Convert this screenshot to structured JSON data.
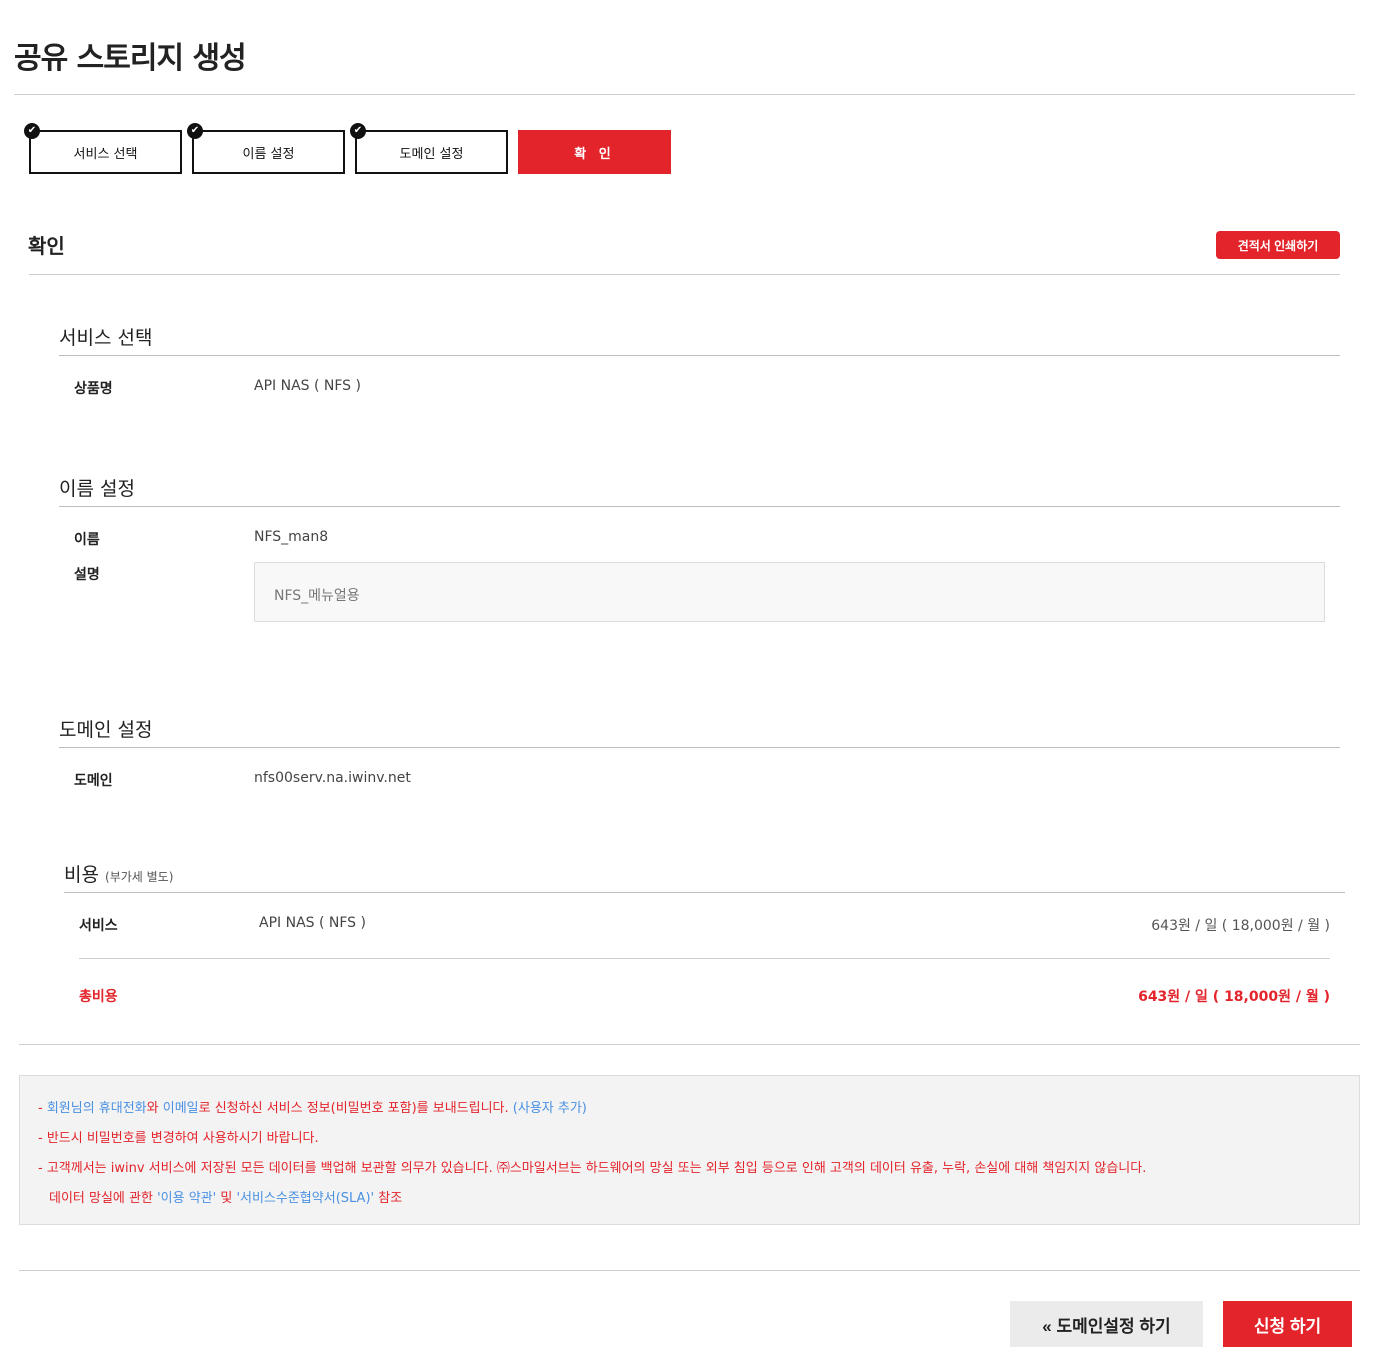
{
  "page_title": "공유 스토리지 생성",
  "steps": [
    {
      "label": "서비스 선택",
      "done": true
    },
    {
      "label": "이름 설정",
      "done": true
    },
    {
      "label": "도메인 설정",
      "done": true
    },
    {
      "label": "확 인",
      "done": false,
      "active": true
    }
  ],
  "confirm": {
    "title": "확인",
    "print_button": "견적서 인쇄하기"
  },
  "service_section": {
    "title": "서비스 선택",
    "product_label": "상품명",
    "product_value": "API NAS ( NFS )"
  },
  "name_section": {
    "title": "이름 설정",
    "name_label": "이름",
    "name_value": "NFS_man8",
    "desc_label": "설명",
    "desc_value": "NFS_메뉴얼용"
  },
  "domain_section": {
    "title": "도메인 설정",
    "domain_label": "도메인",
    "domain_value": "nfs00serv.na.iwinv.net"
  },
  "cost_section": {
    "title": "비용",
    "note": "(부가세 별도)",
    "service_label": "서비스",
    "service_value": "API NAS ( NFS )",
    "service_price": "643원 / 일 ( 18,000원 / 월 )",
    "total_label": "총비용",
    "total_price": "643원 / 일 ( 18,000원 / 월 )"
  },
  "notice": {
    "line1_prefix": "- ",
    "line1_link1": "회원님의 휴대전화",
    "line1_mid1": "와 ",
    "line1_link2": "이메일",
    "line1_mid2": "로 신청하신 서비스 정보(비밀번호 포함)를 보내드립니다. ",
    "line1_link3": "(사용자 추가)",
    "line2": "- 반드시 비밀번호를 변경하여 사용하시기 바랍니다.",
    "line3": "- 고객께서는 iwinv 서비스에 저장된 모든 데이터를 백업해 보관할 의무가 있습니다. ㈜스마일서브는 하드웨어의 망실 또는 외부 침입 등으로 인해 고객의 데이터 유출, 누락, 손실에 대해 책임지지 않습니다.",
    "line4_prefix": "데이터 망실에 관한 ",
    "line4_link1": "'이용 약관'",
    "line4_mid": " 및 ",
    "line4_link2": "'서비스수준협약서(SLA)'",
    "line4_suffix": " 참조"
  },
  "buttons": {
    "prev": "« 도메인설정 하기",
    "submit": "신청 하기"
  },
  "colors": {
    "accent": "#e3242b",
    "link": "#4a90e2"
  }
}
